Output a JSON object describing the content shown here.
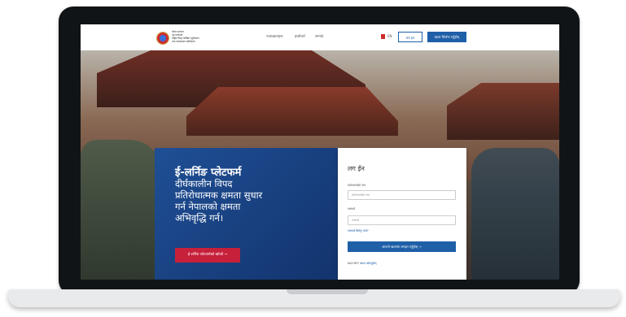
{
  "header": {
    "org_lines": [
      "नेपाल सरकार",
      "गृह मन्त्रालय",
      "राष्ट्रिय विपद् जोखिम न्यूनीकरण",
      "तथा व्यवस्थापन प्राधिकरण"
    ],
    "nav": [
      "पाठ्यक्रमहरू",
      "हाम्रोबारे",
      "सम्पर्क"
    ],
    "lang_label": "EN",
    "login_button": "लग इन",
    "register_button": "खाता सिर्जना गर्नुहोस्"
  },
  "hero": {
    "title": "ई-लर्निङ प्लेटफर्म",
    "subtitle_lines": [
      "दीर्घकालीन विपद",
      "प्रतिरोधात्मक क्षमता सुधार",
      "गर्न नेपालको क्षमता",
      "अभिवृद्धि गर्न।"
    ],
    "explore_button": "ई-लर्निङ प्लेटफर्मको खोजी →"
  },
  "login": {
    "title": "लग ईन",
    "username_label": "प्रयोगकर्ताको नाम",
    "username_placeholder": "प्रयोगकर्ताको नाम",
    "password_label": "पासवर्ड",
    "password_placeholder": "पासवर्ड",
    "forgot_link": "पासवर्ड बिर्सनु भयो?",
    "submit_button": "आफ्नो खातामा लगइन गर्नुहोस् →",
    "signup_prefix": "खाता छैन?",
    "signup_link": "खाता खोल्नुहोस्"
  },
  "colors": {
    "primary": "#1f5fa8",
    "accent_red": "#c6203b",
    "panel_blue": "#1a3f80"
  }
}
